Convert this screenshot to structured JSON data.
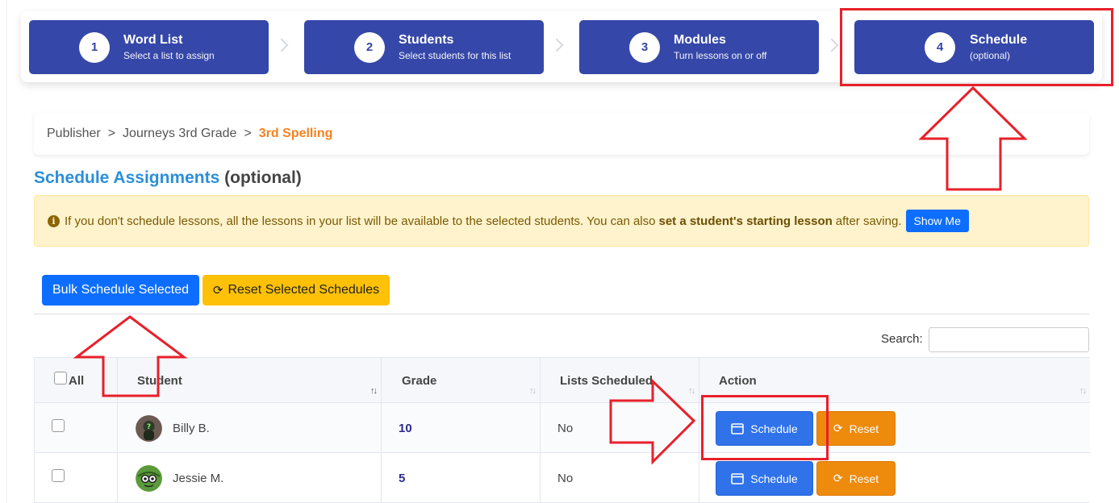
{
  "stepper": {
    "steps": [
      {
        "number": "1",
        "title": "Word List",
        "subtitle": "Select a list to assign"
      },
      {
        "number": "2",
        "title": "Students",
        "subtitle": "Select students for this list"
      },
      {
        "number": "3",
        "title": "Modules",
        "subtitle": "Turn lessons on or off"
      },
      {
        "number": "4",
        "title": "Schedule",
        "subtitle": "(optional)"
      }
    ]
  },
  "breadcrumb": {
    "items": [
      "Publisher",
      "Journeys 3rd Grade",
      "3rd Spelling"
    ],
    "separator": ">"
  },
  "heading": {
    "main": "Schedule Assignments",
    "suffix": "(optional)"
  },
  "alert": {
    "icon": "info-icon",
    "text_before": "If you don't schedule lessons, all the lessons in your list will be available to the selected students. You can also",
    "bold_text": "set a student's starting lesson",
    "text_after": "after saving.",
    "button_label": "Show Me"
  },
  "bulk": {
    "bulk_schedule_label": "Bulk Schedule Selected",
    "reset_selected_label": "Reset Selected Schedules"
  },
  "search": {
    "label": "Search:",
    "value": ""
  },
  "table": {
    "headers": {
      "all": "All",
      "student": "Student",
      "grade": "Grade",
      "lists": "Lists Scheduled",
      "action": "Action"
    },
    "rows": [
      {
        "name": "Billy B.",
        "grade": "10",
        "lists_scheduled": "No",
        "schedule_label": "Schedule",
        "reset_label": "Reset"
      },
      {
        "name": "Jessie M.",
        "grade": "5",
        "lists_scheduled": "No",
        "schedule_label": "Schedule",
        "reset_label": "Reset"
      }
    ]
  },
  "colors": {
    "step_bg": "#3547a8",
    "breadcrumb_active": "#f58220",
    "heading_blue": "#2b8fd9",
    "primary_blue": "#0d6efd",
    "warning_yellow": "#ffc107",
    "reset_orange": "#ee8a0c",
    "annotation_red": "#e8202a"
  }
}
